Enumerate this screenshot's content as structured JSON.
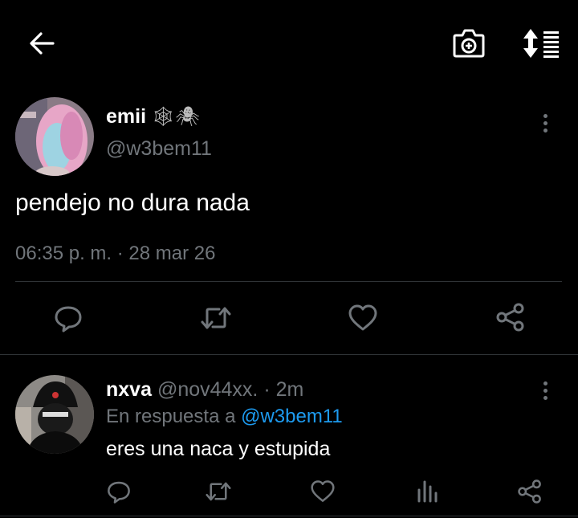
{
  "header": {
    "back_icon": "arrow-left-icon",
    "camera_icon": "camera-plus-icon",
    "sort_icon": "sort-icon"
  },
  "tweet": {
    "display_name": "emii",
    "emojis": "🕸🕷",
    "handle": "@w3bem11",
    "text": "pendejo no dura nada",
    "time": "06:35 p. m.",
    "separator": "·",
    "date": "28 mar 26",
    "actions": [
      "reply-icon",
      "retweet-icon",
      "like-icon",
      "share-icon"
    ]
  },
  "reply": {
    "display_name": "nxva",
    "handle": "@nov44xx.",
    "separator": "·",
    "time": "2m",
    "replying_prefix": "En respuesta a",
    "replying_to": "@w3bem11",
    "text": "eres una naca y estupida",
    "actions": [
      "reply-icon",
      "retweet-icon",
      "like-icon",
      "analytics-icon",
      "share-icon"
    ]
  },
  "colors": {
    "background": "#000000",
    "text": "#e7e9ea",
    "muted": "#71767b",
    "link": "#1d9bf0",
    "divider": "#2f3336"
  }
}
